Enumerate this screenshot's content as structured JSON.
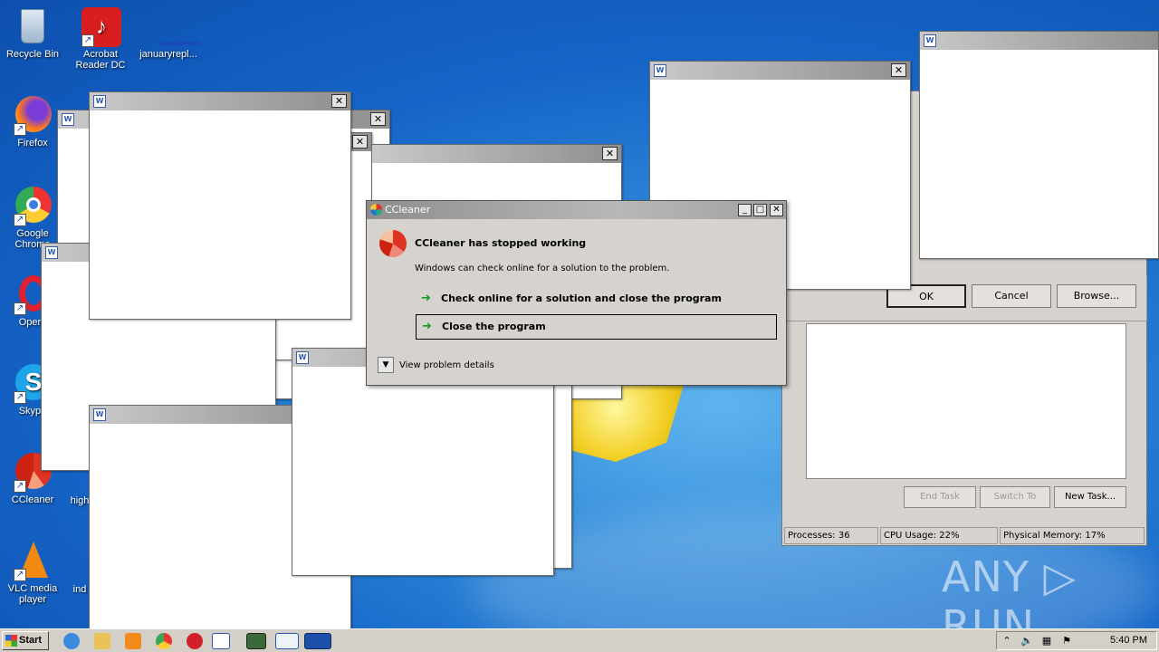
{
  "desktop": {
    "icons": [
      {
        "label": "Recycle Bin"
      },
      {
        "label": "Acrobat Reader DC"
      },
      {
        "label": "januaryrepl..."
      },
      {
        "label": "Firefox"
      },
      {
        "label": "Google Chrome"
      },
      {
        "label": "Opera"
      },
      {
        "label": "Skype"
      },
      {
        "label": "CCleaner"
      },
      {
        "label": "high"
      },
      {
        "label": "VLC media player"
      },
      {
        "label": "ind"
      }
    ],
    "watermark": "ANY ▷ RUN"
  },
  "dialog": {
    "title": "CCleaner",
    "headline": "CCleaner has stopped working",
    "subtext": "Windows can check online for a solution to the problem.",
    "option_check": "Check online for a solution and close the program",
    "option_close": "Close the program",
    "details": "View problem details",
    "controls": {
      "minimize": "_",
      "maximize": "□",
      "close": "✕"
    }
  },
  "browse_dialog": {
    "ok": "OK",
    "cancel": "Cancel",
    "browse": "Browse..."
  },
  "taskmgr": {
    "end_task": "End Task",
    "switch_to": "Switch To",
    "new_task": "New Task...",
    "processes": "Processes: 36",
    "cpu": "CPU Usage: 22%",
    "memory": "Physical Memory: 17%"
  },
  "taskbar": {
    "start": "Start",
    "clock": "5:40 PM"
  },
  "window_icon_label": "W",
  "close_glyph": "✕"
}
